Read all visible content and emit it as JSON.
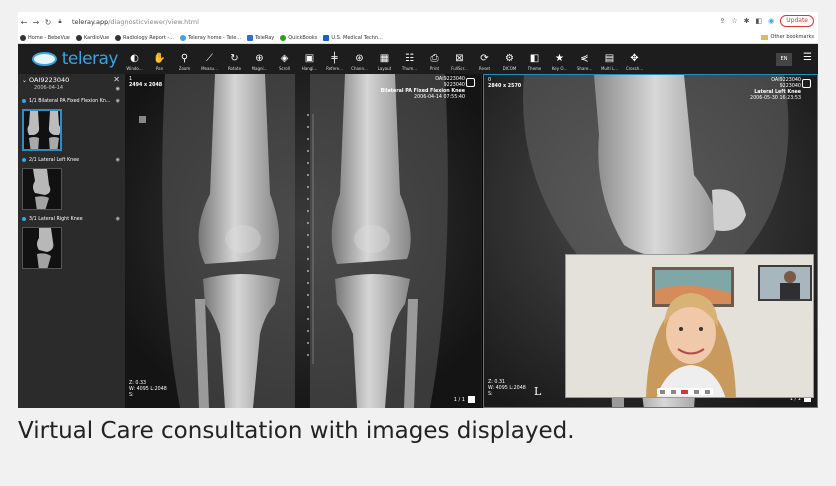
{
  "browser": {
    "url_host": "teleray.app",
    "url_path": "/diagnosticviewer/view.html",
    "update_label": "Update",
    "bookmarks": [
      "Home - BebeVue",
      "KardioVue",
      "Radiology Report -...",
      "Teleray home - Tele...",
      "TeleRay",
      "QuickBooks",
      "U.S. Medical Techn..."
    ],
    "other_bookmarks": "Other bookmarks"
  },
  "app": {
    "logo": "teleray",
    "lang": "EN",
    "tools": [
      {
        "label": "Windo...",
        "icon": "contrast-icon",
        "glyph": "◐"
      },
      {
        "label": "Pan",
        "icon": "hand-icon",
        "glyph": "✋"
      },
      {
        "label": "Zoom",
        "icon": "zoom-icon",
        "glyph": "⚲"
      },
      {
        "label": "Measu...",
        "icon": "ruler-icon",
        "glyph": "⟋"
      },
      {
        "label": "Rotate",
        "icon": "rotate-icon",
        "glyph": "↻"
      },
      {
        "label": "Magni...",
        "icon": "magnify-icon",
        "glyph": "⊕"
      },
      {
        "label": "Scroll",
        "icon": "layers-icon",
        "glyph": "◈"
      },
      {
        "label": "Hangi...",
        "icon": "hanging-icon",
        "glyph": "▣"
      },
      {
        "label": "Refere...",
        "icon": "reference-icon",
        "glyph": "╪"
      },
      {
        "label": "Chann...",
        "icon": "channel-icon",
        "glyph": "⊛"
      },
      {
        "label": "Layout",
        "icon": "grid-icon",
        "glyph": "▦"
      },
      {
        "label": "Thum...",
        "icon": "thumbnail-icon",
        "glyph": "☷"
      },
      {
        "label": "Print",
        "icon": "print-icon",
        "glyph": "⎙"
      },
      {
        "label": "FullScr...",
        "icon": "fullscreen-icon",
        "glyph": "⊠"
      },
      {
        "label": "Reset",
        "icon": "reset-icon",
        "glyph": "⟳"
      },
      {
        "label": "DICOM",
        "icon": "dicom-icon",
        "glyph": "⚙"
      },
      {
        "label": "Theme",
        "icon": "theme-icon",
        "glyph": "◧"
      },
      {
        "label": "Key O...",
        "icon": "star-icon",
        "glyph": "★"
      },
      {
        "label": "Share...",
        "icon": "share-icon",
        "glyph": "⋞"
      },
      {
        "label": "Multi L...",
        "icon": "multi-icon",
        "glyph": "▤"
      },
      {
        "label": "Crossh...",
        "icon": "crosshair-icon",
        "glyph": "✥"
      }
    ]
  },
  "sidebar": {
    "patient_id": "OAI9223040",
    "patient_date": "2006-04-14",
    "series": [
      {
        "label": "1/1 Bilateral PA Fixed Flexion Kn..."
      },
      {
        "label": "2/1 Lateral Left Knee"
      },
      {
        "label": "3/1 Lateral Right Knee"
      }
    ]
  },
  "viewer1": {
    "index": "1",
    "size": "2494 x 2048",
    "patient": "OAI9223040",
    "patient_num": "9223040",
    "study": "Bilateral PA Fixed Flexion Knee",
    "datetime": "2006-04-14 07:55:40",
    "zoom": "Z: 0.33",
    "window": "W: 4095 L:2048",
    "slice": "S:",
    "page": "1 / 1"
  },
  "viewer2": {
    "index": "0",
    "size": "2840 x 2570",
    "patient": "OAI9223040",
    "patient_num": "9223040",
    "study": "Lateral Left Knee",
    "datetime": "2006-05-30 16:23:53",
    "zoom": "Z: 0.31",
    "window": "W: 4095 L:2048",
    "slice": "S:",
    "marker": "L",
    "page": "1 / 1"
  },
  "caption": "Virtual Care consultation with images displayed.",
  "colors": {
    "accent": "#3aa3e0",
    "toolbar": "#1d1d1d",
    "sidebar": "#2b2b2b"
  }
}
